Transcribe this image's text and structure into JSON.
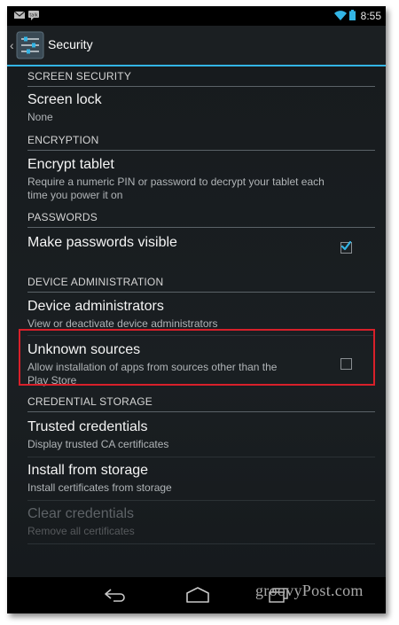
{
  "status_bar": {
    "time": "8:55",
    "icons": [
      "gmail-icon",
      "talk-icon",
      "wifi-icon",
      "battery-icon"
    ]
  },
  "action_bar": {
    "title": "Security",
    "icon": "settings-sliders-icon",
    "back": "back-caret-icon",
    "accent_color": "#33b5e5"
  },
  "sections": {
    "screen_security": {
      "header": "SCREEN SECURITY",
      "screen_lock": {
        "title": "Screen lock",
        "summary": "None"
      }
    },
    "encryption": {
      "header": "ENCRYPTION",
      "encrypt_tablet": {
        "title": "Encrypt tablet",
        "summary_line1": "Require a numeric PIN or password to decrypt your tablet each",
        "summary_line2": "time you power it on"
      }
    },
    "passwords": {
      "header": "PASSWORDS",
      "make_visible": {
        "title": "Make passwords visible",
        "checked": true
      }
    },
    "device_administration": {
      "header": "DEVICE ADMINISTRATION",
      "device_admins": {
        "title": "Device administrators",
        "summary": "View or deactivate device administrators"
      },
      "unknown_sources": {
        "title": "Unknown sources",
        "summary_line1": "Allow installation of apps from sources other than the",
        "summary_line2": "Play Store",
        "checked": false,
        "highlight_color": "#d8202a"
      }
    },
    "credential_storage": {
      "header": "CREDENTIAL STORAGE",
      "trusted_credentials": {
        "title": "Trusted credentials",
        "summary": "Display trusted CA certificates"
      },
      "install_from_storage": {
        "title": "Install from storage",
        "summary": "Install certificates from storage"
      },
      "clear_credentials": {
        "title": "Clear credentials",
        "summary": "Remove all certificates",
        "enabled": false
      }
    }
  },
  "nav_bar": {
    "buttons": [
      "back-icon",
      "home-icon",
      "recent-apps-icon"
    ]
  },
  "watermark": "groovyPost.com"
}
